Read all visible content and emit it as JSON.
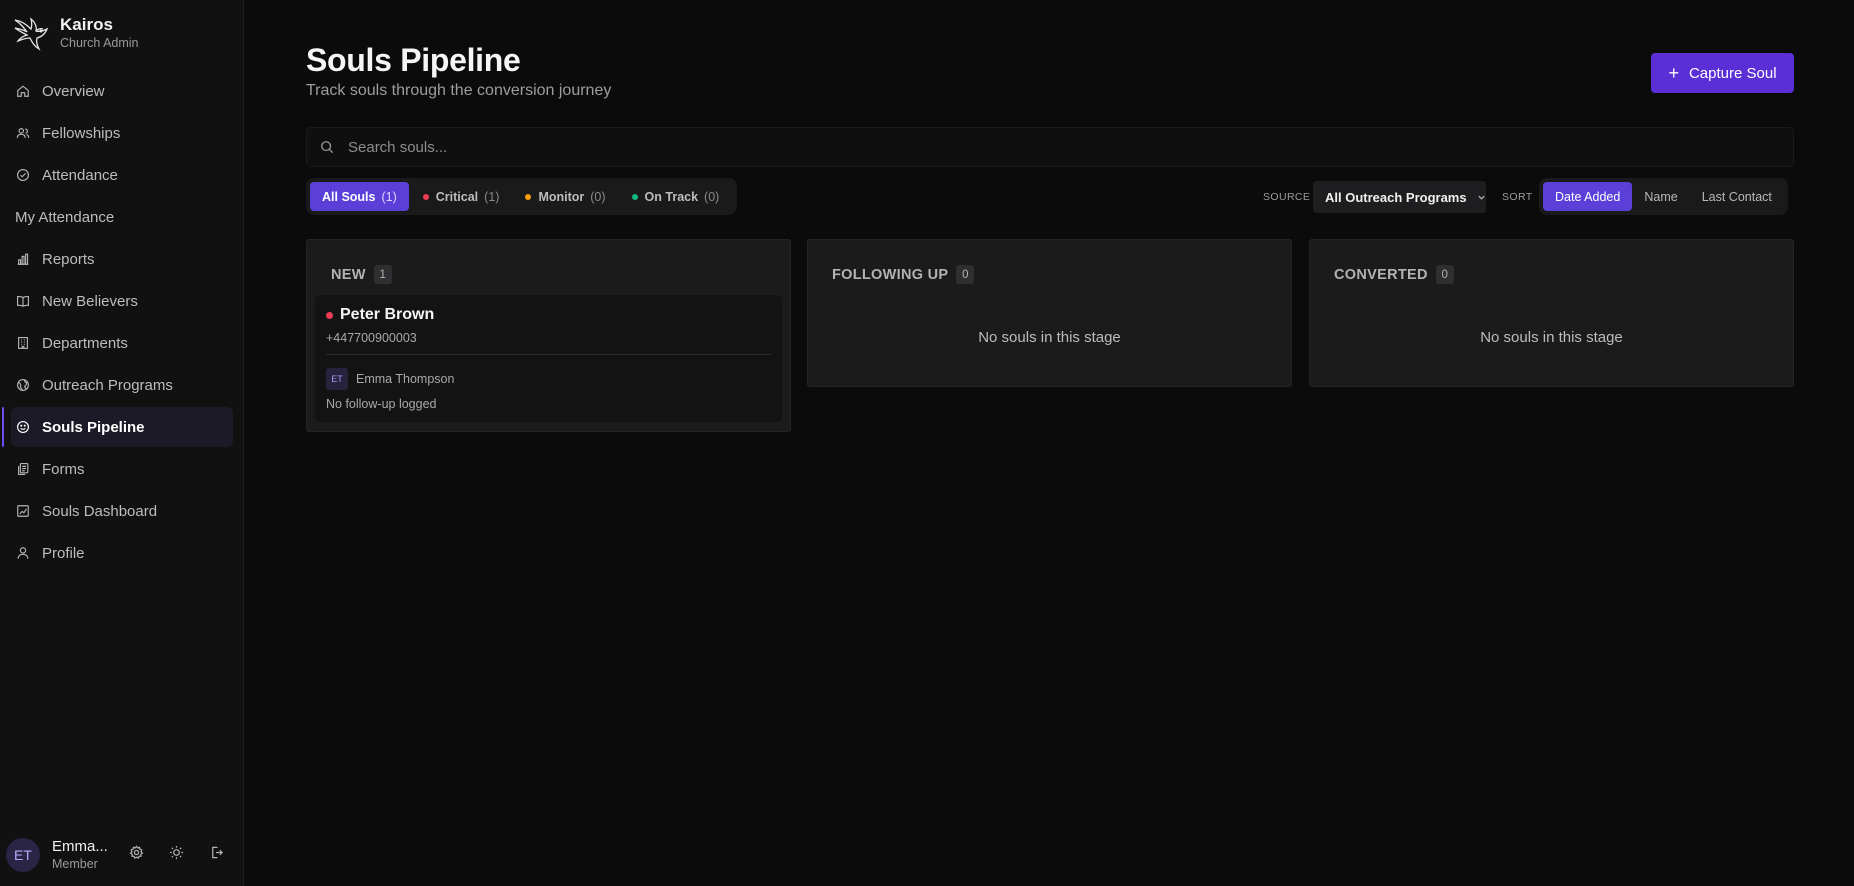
{
  "brand": {
    "name": "Kairos",
    "subtitle": "Church Admin",
    "logo_icon": "dove-icon"
  },
  "sidebar": {
    "items": [
      {
        "label": "Overview",
        "icon": "home-icon",
        "active": false
      },
      {
        "label": "Fellowships",
        "icon": "users-icon",
        "active": false
      },
      {
        "label": "Attendance",
        "icon": "check-circle-icon",
        "active": false
      },
      {
        "label": "My Attendance",
        "icon": "",
        "active": false
      },
      {
        "label": "Reports",
        "icon": "bar-chart-icon",
        "active": false
      },
      {
        "label": "New Believers",
        "icon": "book-icon",
        "active": false
      },
      {
        "label": "Departments",
        "icon": "building-icon",
        "active": false
      },
      {
        "label": "Outreach Programs",
        "icon": "globe-icon",
        "active": false
      },
      {
        "label": "Souls Pipeline",
        "icon": "smile-icon",
        "active": true
      },
      {
        "label": "Forms",
        "icon": "copy-icon",
        "active": false
      },
      {
        "label": "Souls Dashboard",
        "icon": "chart-icon",
        "active": false
      },
      {
        "label": "Profile",
        "icon": "user-icon",
        "active": false
      }
    ]
  },
  "user": {
    "initials": "ET",
    "name": "Emma...",
    "role": "Member"
  },
  "header": {
    "title": "Souls Pipeline",
    "subtitle": "Track souls through the conversion journey",
    "capture_label": "Capture Soul",
    "capture_icon": "+"
  },
  "search": {
    "placeholder": "Search souls...",
    "value": ""
  },
  "filters": [
    {
      "label": "All Souls",
      "count": "(1)",
      "active": true,
      "dot": ""
    },
    {
      "label": "Critical",
      "count": "(1)",
      "active": false,
      "dot": "#ef3b54"
    },
    {
      "label": "Monitor",
      "count": "(0)",
      "active": false,
      "dot": "#f59e0b"
    },
    {
      "label": "On Track",
      "count": "(0)",
      "active": false,
      "dot": "#10b981"
    }
  ],
  "source": {
    "label": "SOURCE",
    "value": "All Outreach Programs"
  },
  "sort": {
    "label": "SORT",
    "options": [
      {
        "label": "Date Added",
        "active": true
      },
      {
        "label": "Name",
        "active": false
      },
      {
        "label": "Last Contact",
        "active": false
      }
    ]
  },
  "columns": [
    {
      "title": "NEW",
      "count": "1",
      "cards": [
        {
          "name": "Peter Brown",
          "phone": "+447700900003",
          "owner_initials": "ET",
          "owner_name": "Emma Thompson",
          "note": "No follow-up logged",
          "status_color": "#ef3b54"
        }
      ]
    },
    {
      "title": "FOLLOWING UP",
      "count": "0",
      "empty": "No souls in this stage",
      "cards": []
    },
    {
      "title": "CONVERTED",
      "count": "0",
      "empty": "No souls in this stage",
      "cards": []
    }
  ],
  "colors": {
    "accent": "#5b3fd9",
    "critical": "#ef3b54",
    "monitor": "#f59e0b",
    "on_track": "#10b981"
  }
}
